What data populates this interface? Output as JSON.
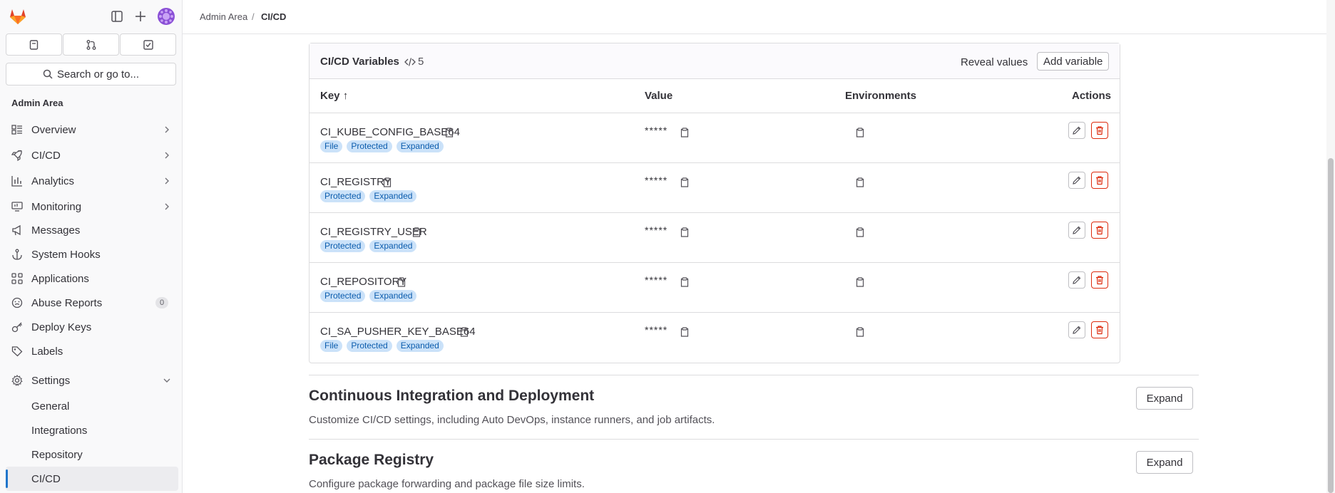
{
  "header": {
    "breadcrumb": [
      "Admin Area",
      "CI/CD"
    ],
    "breadcrumb_sep": "/"
  },
  "sidebar": {
    "search_label": "Search or go to...",
    "section_title": "Admin Area",
    "items": [
      {
        "label": "Overview",
        "icon": "overview-icon",
        "chevron": true
      },
      {
        "label": "CI/CD",
        "icon": "rocket-icon",
        "chevron": true
      },
      {
        "label": "Analytics",
        "icon": "chart-icon",
        "chevron": true
      },
      {
        "label": "Monitoring",
        "icon": "monitor-icon",
        "chevron": true
      },
      {
        "label": "Messages",
        "icon": "megaphone-icon"
      },
      {
        "label": "System Hooks",
        "icon": "anchor-icon"
      },
      {
        "label": "Applications",
        "icon": "apps-icon"
      },
      {
        "label": "Abuse Reports",
        "icon": "smiley-icon",
        "badge": "0"
      },
      {
        "label": "Deploy Keys",
        "icon": "key-icon"
      },
      {
        "label": "Labels",
        "icon": "label-icon"
      },
      {
        "label": "Settings",
        "icon": "settings-icon",
        "expanded": true
      }
    ],
    "subitems": [
      {
        "label": "General"
      },
      {
        "label": "Integrations"
      },
      {
        "label": "Repository"
      },
      {
        "label": "CI/CD",
        "active": true
      }
    ]
  },
  "variables": {
    "title": "CI/CD Variables",
    "count": "5",
    "reveal_label": "Reveal values",
    "add_label": "Add variable",
    "columns": {
      "key": "Key",
      "key_sort": "↑",
      "value": "Value",
      "env": "Environments",
      "actions": "Actions"
    },
    "masked": "*****",
    "rows": [
      {
        "key": "CI_KUBE_CONFIG_BASE64",
        "tags": [
          "File",
          "Protected",
          "Expanded"
        ]
      },
      {
        "key": "CI_REGISTRY",
        "tags": [
          "Protected",
          "Expanded"
        ]
      },
      {
        "key": "CI_REGISTRY_USER",
        "tags": [
          "Protected",
          "Expanded"
        ]
      },
      {
        "key": "CI_REPOSITORY",
        "tags": [
          "Protected",
          "Expanded"
        ]
      },
      {
        "key": "CI_SA_PUSHER_KEY_BASE64",
        "tags": [
          "File",
          "Protected",
          "Expanded"
        ]
      }
    ]
  },
  "sections": [
    {
      "title": "Continuous Integration and Deployment",
      "desc": "Customize CI/CD settings, including Auto DevOps, instance runners, and job artifacts.",
      "button": "Expand"
    },
    {
      "title": "Package Registry",
      "desc": "Configure package forwarding and package file size limits.",
      "button": "Expand"
    }
  ],
  "colors": {
    "accent": "#1f75cb",
    "danger": "#dd2b0e",
    "tag_bg": "#cbe2f9"
  }
}
